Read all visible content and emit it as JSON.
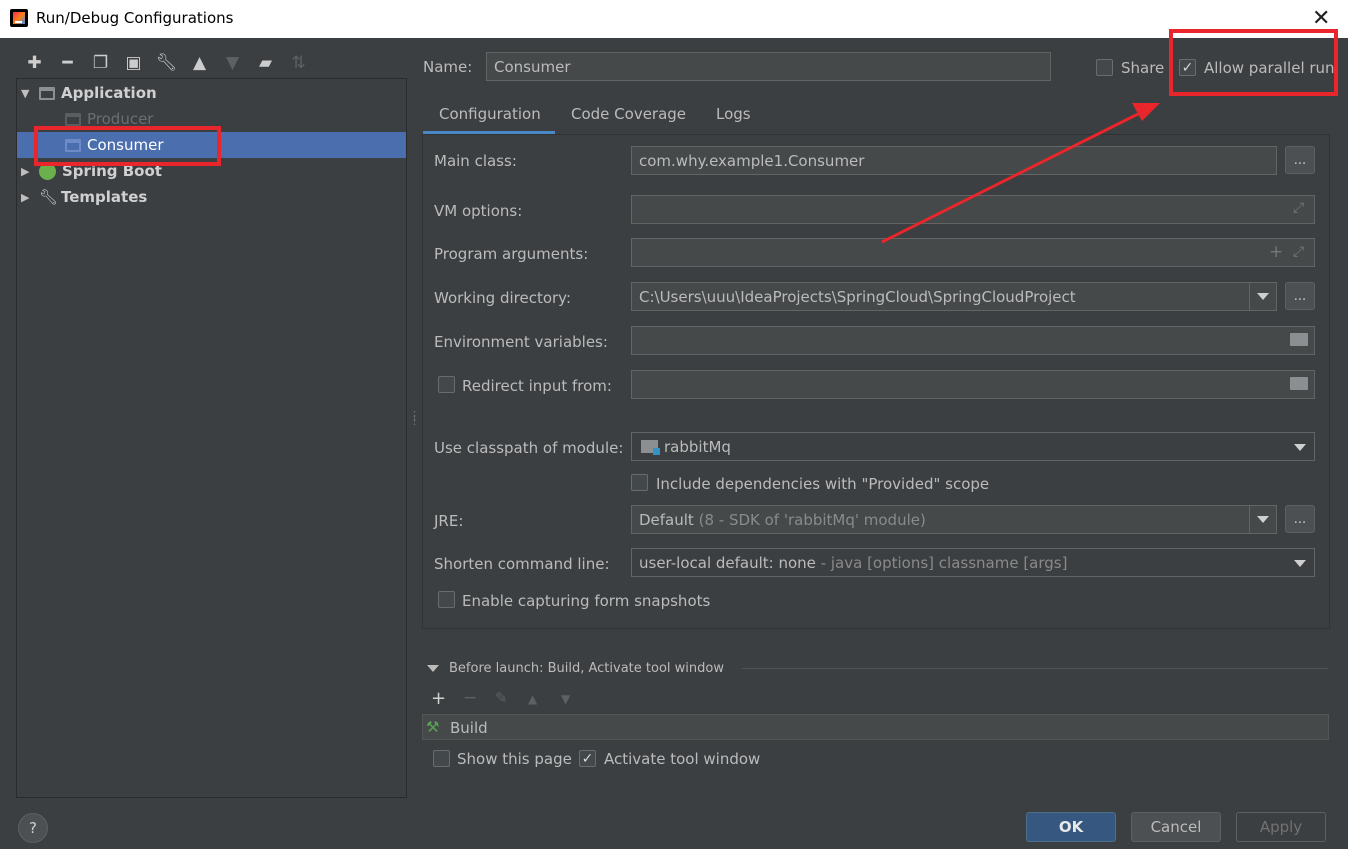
{
  "window": {
    "title": "Run/Debug Configurations"
  },
  "tree": {
    "items": [
      {
        "label": "Application"
      },
      {
        "label": "Producer"
      },
      {
        "label": "Consumer"
      },
      {
        "label": "Spring Boot"
      },
      {
        "label": "Templates"
      }
    ]
  },
  "header": {
    "name_label": "Name:",
    "name_value": "Consumer",
    "share_label": "Share",
    "share_checked": false,
    "parallel_label": "Allow parallel run",
    "parallel_checked": true
  },
  "tabs": [
    {
      "label": "Configuration",
      "active": true
    },
    {
      "label": "Code Coverage",
      "active": false
    },
    {
      "label": "Logs",
      "active": false
    }
  ],
  "form": {
    "main_class_label": "Main class:",
    "main_class_value": "com.why.example1.Consumer",
    "vm_options_label": "VM options:",
    "program_args_label": "Program arguments:",
    "working_dir_label": "Working directory:",
    "working_dir_value": "C:\\Users\\uuu\\IdeaProjects\\SpringCloud\\SpringCloudProject",
    "env_vars_label": "Environment variables:",
    "redirect_label": "Redirect input from:",
    "classpath_label": "Use classpath of module:",
    "classpath_value": "rabbitMq",
    "include_deps_label": "Include dependencies with \"Provided\" scope",
    "jre_label": "JRE:",
    "jre_value": "Default",
    "jre_hint": "(8 - SDK of 'rabbitMq' module)",
    "shorten_label": "Shorten command line:",
    "shorten_value": "user-local default: none",
    "shorten_hint": " - java [options] classname [args]",
    "snapshots_label": "Enable capturing form snapshots",
    "ellipsis": "..."
  },
  "before_launch": {
    "title": "Before launch: Build, Activate tool window",
    "task": "Build",
    "show_page_label": "Show this page",
    "show_page_checked": false,
    "activate_label": "Activate tool window",
    "activate_checked": true
  },
  "buttons": {
    "ok": "OK",
    "cancel": "Cancel",
    "apply": "Apply",
    "help": "?"
  },
  "colors": {
    "background": "#3c3f41",
    "selection": "#4b6eaf",
    "annotation_red": "#e8262b",
    "ok_button": "#365880"
  }
}
